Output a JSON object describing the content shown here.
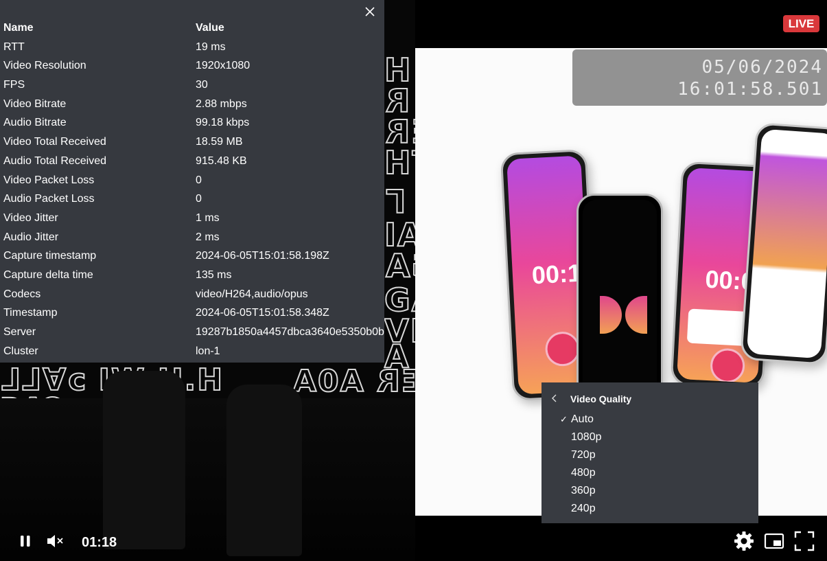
{
  "live_badge": "LIVE",
  "overlay": {
    "date": "05/06/2024",
    "time": "16:01:58.501"
  },
  "right_video": {
    "phone_left_timer": "00:14",
    "phone_right_timer": "00:00"
  },
  "stats": {
    "header": {
      "name": "Name",
      "value": "Value"
    },
    "rows": [
      {
        "name": "RTT",
        "value": "19 ms"
      },
      {
        "name": "Video Resolution",
        "value": "1920x1080"
      },
      {
        "name": "FPS",
        "value": "30"
      },
      {
        "name": "Video Bitrate",
        "value": "2.88 mbps"
      },
      {
        "name": "Audio Bitrate",
        "value": "99.18 kbps"
      },
      {
        "name": "Video Total Received",
        "value": "18.59 MB"
      },
      {
        "name": "Audio Total Received",
        "value": "915.48 KB"
      },
      {
        "name": "Video Packet Loss",
        "value": "0"
      },
      {
        "name": "Audio Packet Loss",
        "value": "0"
      },
      {
        "name": "Video Jitter",
        "value": "1 ms"
      },
      {
        "name": "Audio Jitter",
        "value": "2 ms"
      },
      {
        "name": "Capture timestamp",
        "value": "2024-06-05T15:01:58.198Z"
      },
      {
        "name": "Capture delta time",
        "value": "135 ms"
      },
      {
        "name": "Codecs",
        "value": "video/H264,audio/opus"
      },
      {
        "name": "Timestamp",
        "value": "2024-06-05T15:01:58.348Z"
      },
      {
        "name": "Server",
        "value": "19287b1850a4457dbca3640e5350b0b"
      },
      {
        "name": "Cluster",
        "value": "lon-1"
      }
    ]
  },
  "quality_menu": {
    "title": "Video Quality",
    "selected": "Auto",
    "options": [
      "Auto",
      "1080p",
      "720p",
      "480p",
      "360p",
      "240p"
    ]
  },
  "controls": {
    "current_time": "01:18",
    "icons": [
      "pause-icon",
      "mute-icon",
      "settings-icon",
      "picture-in-picture-icon",
      "fullscreen-icon"
    ]
  }
}
